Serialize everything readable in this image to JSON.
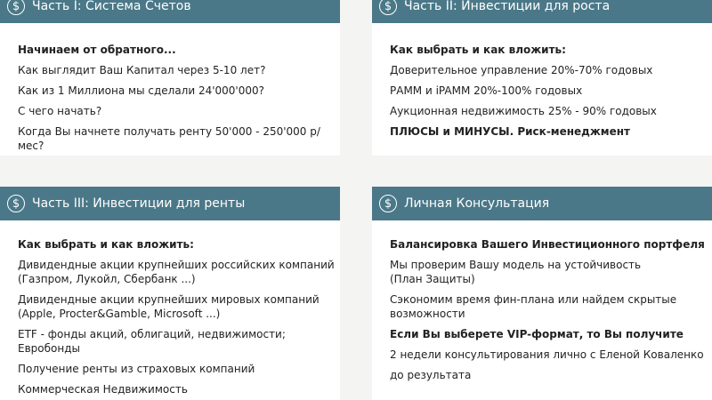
{
  "cards": [
    {
      "title": "Часть I: Система Счетов",
      "icon": "dollar-circle-icon",
      "heading": "Начинаем от обратного...",
      "items": [
        "Как выглядит Ваш Капитал через 5-10 лет?",
        "Как из 1 Миллиона мы сделали 24'000'000?",
        "С чего начать?",
        "Когда Вы начнете получать ренту 50'000 - 250'000 р/мес?"
      ]
    },
    {
      "title": "Часть II: Инвестиции для роста",
      "icon": "dollar-circle-icon",
      "heading": "Как выбрать и как вложить:",
      "items": [
        "Доверительное управление 20%-70% годовых",
        "РАММ и iPAMM 20%-100% годовых",
        "Аукционная недвижимость 25% - 90% годовых"
      ],
      "footer_bold": "ПЛЮСЫ и МИНУСЫ. Риск-менеджмент"
    },
    {
      "title": "Часть III: Инвестиции для ренты",
      "icon": "dollar-circle-icon",
      "heading": "Как выбрать и как вложить:",
      "items": [
        "Дивидендные акции крупнейших российских компаний",
        "(Газпром, Лукойл, Сбербанк ...)",
        "Дивидендные акции крупнейших мировых компаний",
        "(Apple, Procter&Gamble, Microsoft ...)",
        "ETF - фонды акций, облигаций, недвижимости; Евробонды",
        "Получение ренты из страховых компаний",
        "Коммерческая Недвижимость"
      ]
    },
    {
      "title": "Личная Консультация",
      "icon": "dollar-circle-icon",
      "heading": "Балансировка Вашего Инвестиционного портфеля",
      "items": [
        "Мы проверим Вашу модель на устойчивость",
        "(План Защиты)",
        "Сэкономим время фин-плана или найдем скрытые",
        "возможности"
      ],
      "bold_line": "Если Вы выберете VIP-формат, то Вы получите",
      "items2": [
        "2 недели консультирования лично с Еленой Коваленко",
        "до результата"
      ]
    }
  ]
}
